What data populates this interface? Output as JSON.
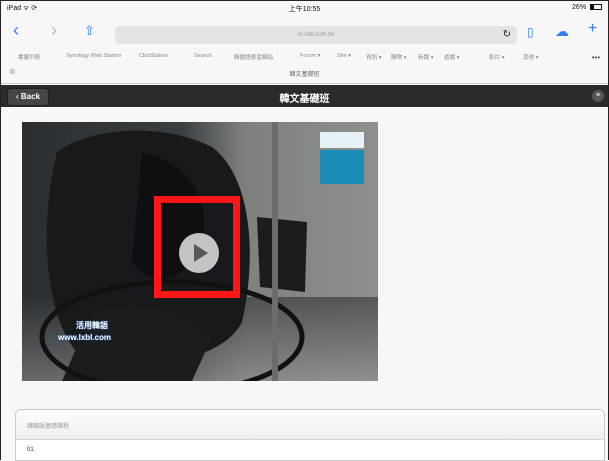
{
  "status_bar": {
    "device": "iPad ᯤ ⟳",
    "time": "上午10:55",
    "battery": "26%"
  },
  "toolbar": {
    "back_icon": "chevron-left-icon",
    "forward_icon": "chevron-right-icon",
    "share_icon": "share-icon",
    "url": "m.lxbl.com.tw",
    "reload_icon": "reload-icon",
    "bookmarks_icon": "book-icon",
    "cloud_icon": "cloud-icon",
    "new_tab_icon": "plus-icon"
  },
  "bookmarks_bar": {
    "items": [
      "書籤列表",
      "Synology Web Station",
      "ClubStation",
      "Search",
      "韓國語學習網站",
      "Forum ▾",
      "Site ▾",
      "資訊 ▾",
      "購物 ▾",
      "新聞 ▾",
      "遊戲 ▾",
      "影片 ▾",
      "其他 ▾"
    ],
    "more": "•••"
  },
  "tab": {
    "title": "韓文基礎班"
  },
  "header": {
    "back_label": "Back",
    "title": "韓文基礎班",
    "menu_icon": "menu-icon"
  },
  "video": {
    "caption_line1": "活用韓語",
    "caption_line2": "www.lxbl.com"
  },
  "card": {
    "title": "韓國語基礎課程",
    "row": "01"
  },
  "colors": {
    "header_bg": "#2b2b2b",
    "highlight": "#ff1616",
    "ios_blue": "#2f7ef6"
  }
}
